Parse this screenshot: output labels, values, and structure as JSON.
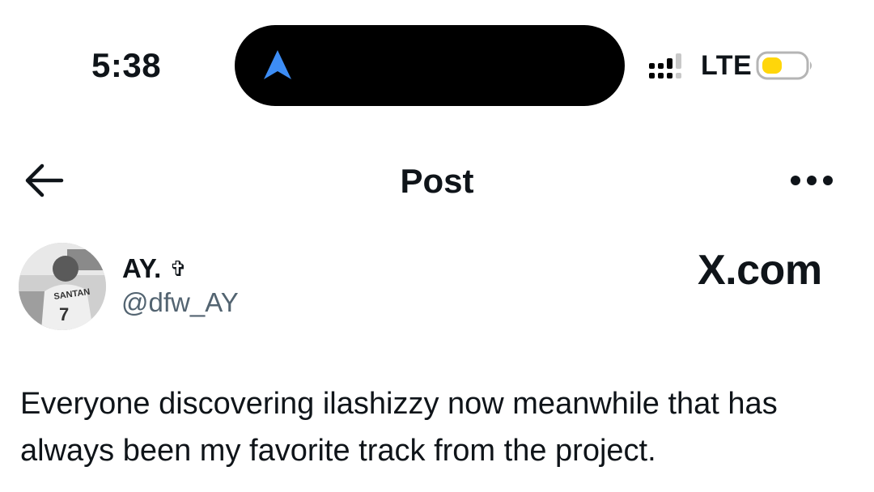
{
  "status_bar": {
    "time": "5:38",
    "network": "LTE",
    "nav_icon": "navigation-arrow-icon",
    "signal_icon": "signal-bars-icon",
    "battery_icon": "battery-low-icon",
    "colors": {
      "nav_arrow": "#3d8df5",
      "battery_fill": "#ffd60a"
    }
  },
  "header": {
    "title": "Post",
    "back_icon": "back-arrow-icon",
    "more_icon": "more-dots-icon"
  },
  "post": {
    "author_name": "AY.",
    "author_badge": "✞",
    "author_handle": "@dfw_AY",
    "avatar_icon": "avatar-photo",
    "brand": "X.com",
    "text": "Everyone discovering ilashizzy now meanwhile that has always been my favorite track from the project."
  }
}
